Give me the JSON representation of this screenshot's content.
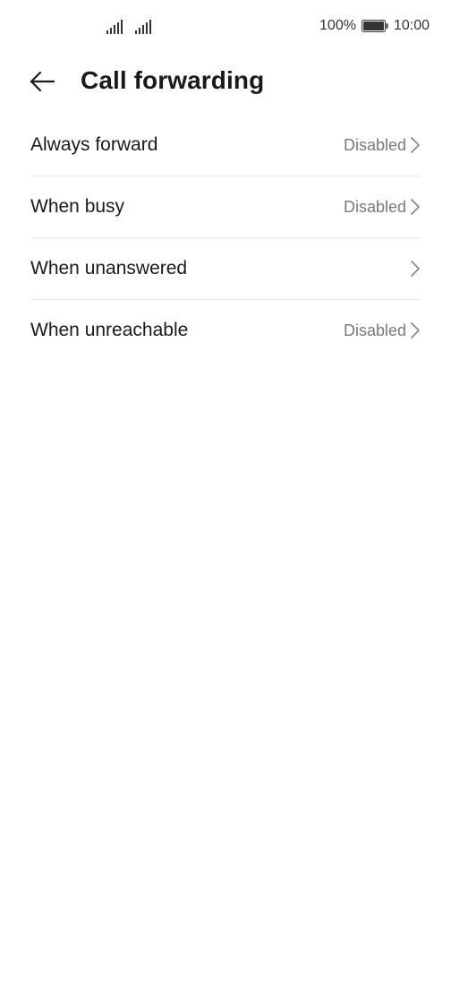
{
  "status_bar": {
    "battery_percent": "100%",
    "time": "10:00",
    "battery_icon": "battery-full-icon",
    "signal_icons": [
      "signal-bars-icon",
      "signal-bars-icon"
    ]
  },
  "header": {
    "back_icon": "arrow-left-icon",
    "title": "Call forwarding"
  },
  "forwarding_options": [
    {
      "label": "Always forward",
      "value": "Disabled"
    },
    {
      "label": "When busy",
      "value": "Disabled"
    },
    {
      "label": "When unanswered",
      "value": ""
    },
    {
      "label": "When unreachable",
      "value": "Disabled"
    }
  ],
  "colors": {
    "text_primary": "#1a1a1a",
    "text_secondary": "#7a7a7a",
    "divider": "#e6e6e6",
    "background": "#ffffff"
  }
}
